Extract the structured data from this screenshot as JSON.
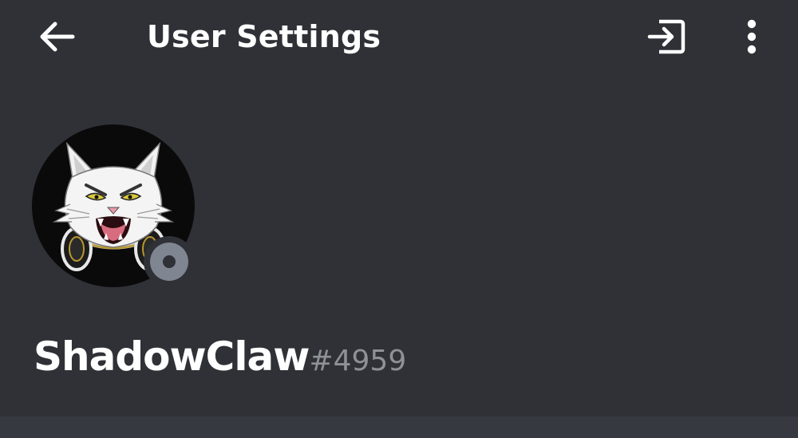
{
  "header": {
    "title": "User Settings",
    "back_icon": "arrow-left-icon",
    "logout_icon": "logout-icon",
    "more_icon": "more-vertical-icon"
  },
  "profile": {
    "username": "ShadowClaw",
    "discriminator": "#4959",
    "avatar_icon": "cat-avatar",
    "status": "offline",
    "status_color": "#7f8591"
  },
  "theme": {
    "background": "#2f3137",
    "text": "#ffffff",
    "muted": "#8e9297"
  }
}
